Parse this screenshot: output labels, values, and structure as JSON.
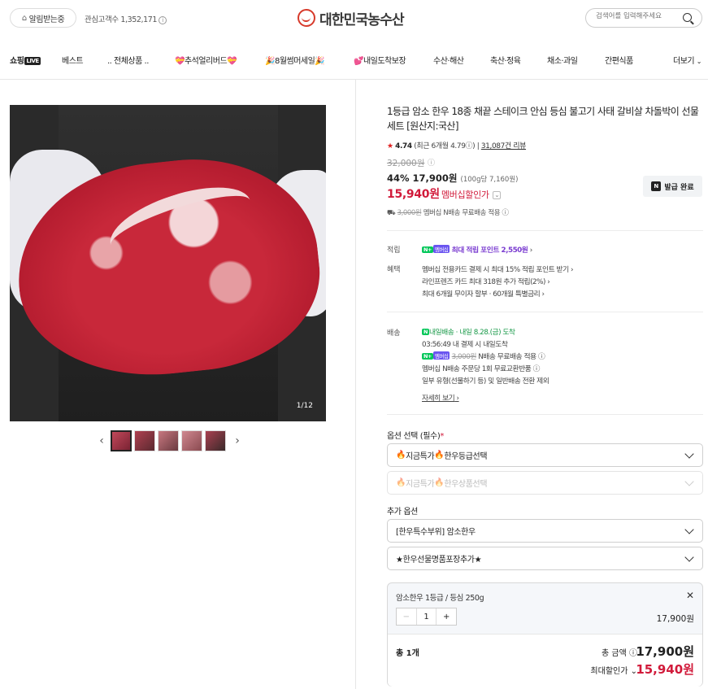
{
  "header": {
    "alarm_label": "알림받는중",
    "interest_text": "관심고객수 1,352,171",
    "logo_text": "대한민국농수산",
    "search_placeholder": "검색어를 입력해주세요"
  },
  "nav": {
    "live_label": "쇼핑",
    "live_badge": "LIVE",
    "items": [
      "베스트",
      ".. 전체상품 ..",
      "💝추석얼리버드💝",
      "🎉8월썸머세일🎉",
      "💕내일도착보장",
      "수산·해산",
      "축산·정육",
      "채소·과일",
      "간편식품"
    ],
    "more": "더보기"
  },
  "gallery": {
    "counter": "1/12"
  },
  "product": {
    "title": "1등급 암소 한우 18종 채끝 스테이크 안심 등심 불고기 사태 갈비살 차돌박이 선물세트 [원산지:국산]",
    "rating_score": "4.74",
    "rating_recent": "(최근 6개월 4.79",
    "review_count": "31,087건 리뷰",
    "original_price": "32,000원",
    "discount_pct": "44%",
    "sale_price": "17,900원",
    "unit_price": "(100g당 7,160원)",
    "member_price": "15,940원",
    "member_label": "멤버십할인가",
    "coupon_label": "발급 완료",
    "shipping_strike": "3,000원",
    "shipping_text": "멤버십 N배송 무료배송 적용"
  },
  "benefits": {
    "points_label": "적립",
    "points_text": "최대 적립 포인트 2,550원",
    "perk_label": "혜택",
    "perks": [
      "멤버십 전용카드 결제 시 최대 15% 적립 포인트 받기",
      "라인프렌즈 카드 최대 318원 추가 적립(2%)",
      "최대 6개월 무이자 할부 · 60개월 특별금리"
    ]
  },
  "delivery": {
    "label": "배송",
    "arrival_tag": "내일배송",
    "arrival": "· 내일 8.28.(금) 도착",
    "deadline": "03:56:49  내 결제 시 내일도착",
    "ship_fee_strike": "3,000원",
    "ship_fee_text": "N배송 무료배송 적용",
    "return_text": "멤버십 N배송 주문당 1회 무료교환반품",
    "return_note": "일부 유형(선물하기 등) 및 일반배송 전환 제외",
    "detail_link": "자세히 보기"
  },
  "options": {
    "required_label": "옵션 선택 (필수)",
    "select1": "지금특가",
    "select1b": "한우등급선택",
    "select2": "지금특가",
    "select2b": "한우상품선택",
    "extra_label": "추가 옵션",
    "extra1": "[한우특수부위] 암소한우",
    "extra2": "★한우선물명품포장추가★"
  },
  "selected": {
    "name": "암소한우 1등급 / 등심 250g",
    "qty": "1",
    "price": "17,900원",
    "total_label": "총 1개",
    "total_amount_label": "총 금액",
    "total_amount": "17,900원",
    "max_discount_label": "최대할인가",
    "max_discount_amount": "15,940원"
  }
}
